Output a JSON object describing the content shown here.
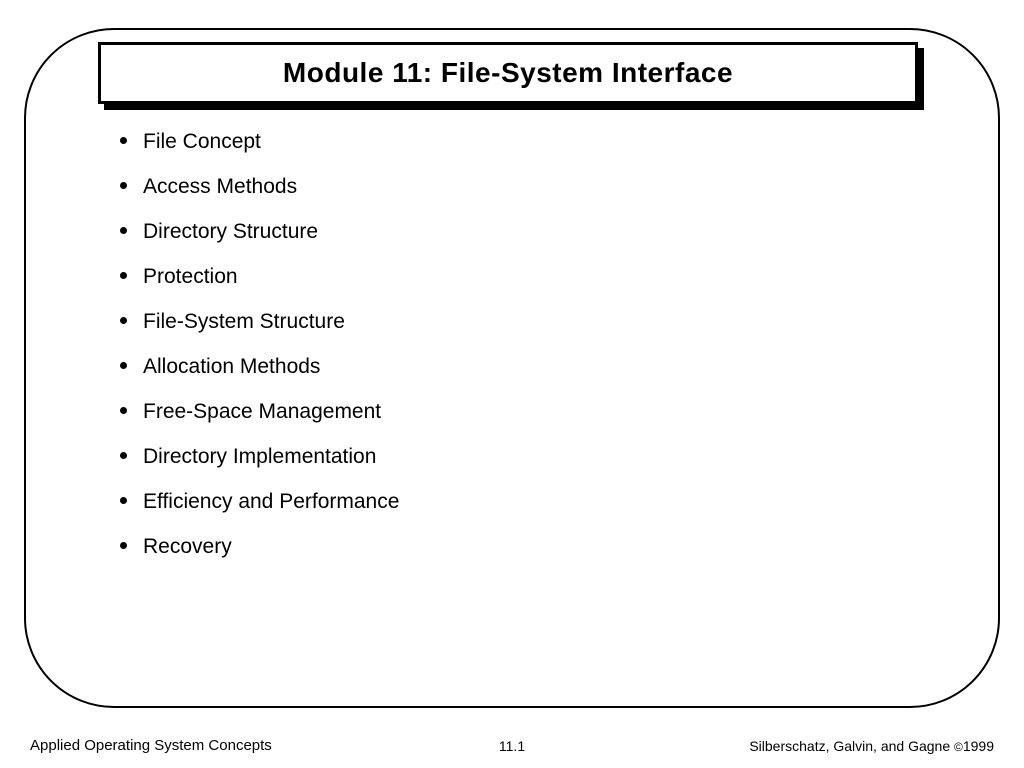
{
  "slide": {
    "title": "Module 11:  File-System Interface",
    "bullets": [
      "File Concept",
      "Access Methods",
      "Directory Structure",
      "Protection",
      "File-System Structure",
      "Allocation Methods",
      "Free-Space Management",
      "Directory Implementation",
      "Efficiency and Performance",
      "Recovery"
    ]
  },
  "footer": {
    "left": "Applied Operating System Concepts",
    "center": "11.1",
    "right_authors": "Silberschatz, Galvin, and Gagne ",
    "right_symbol": "©",
    "right_year": "1999"
  }
}
